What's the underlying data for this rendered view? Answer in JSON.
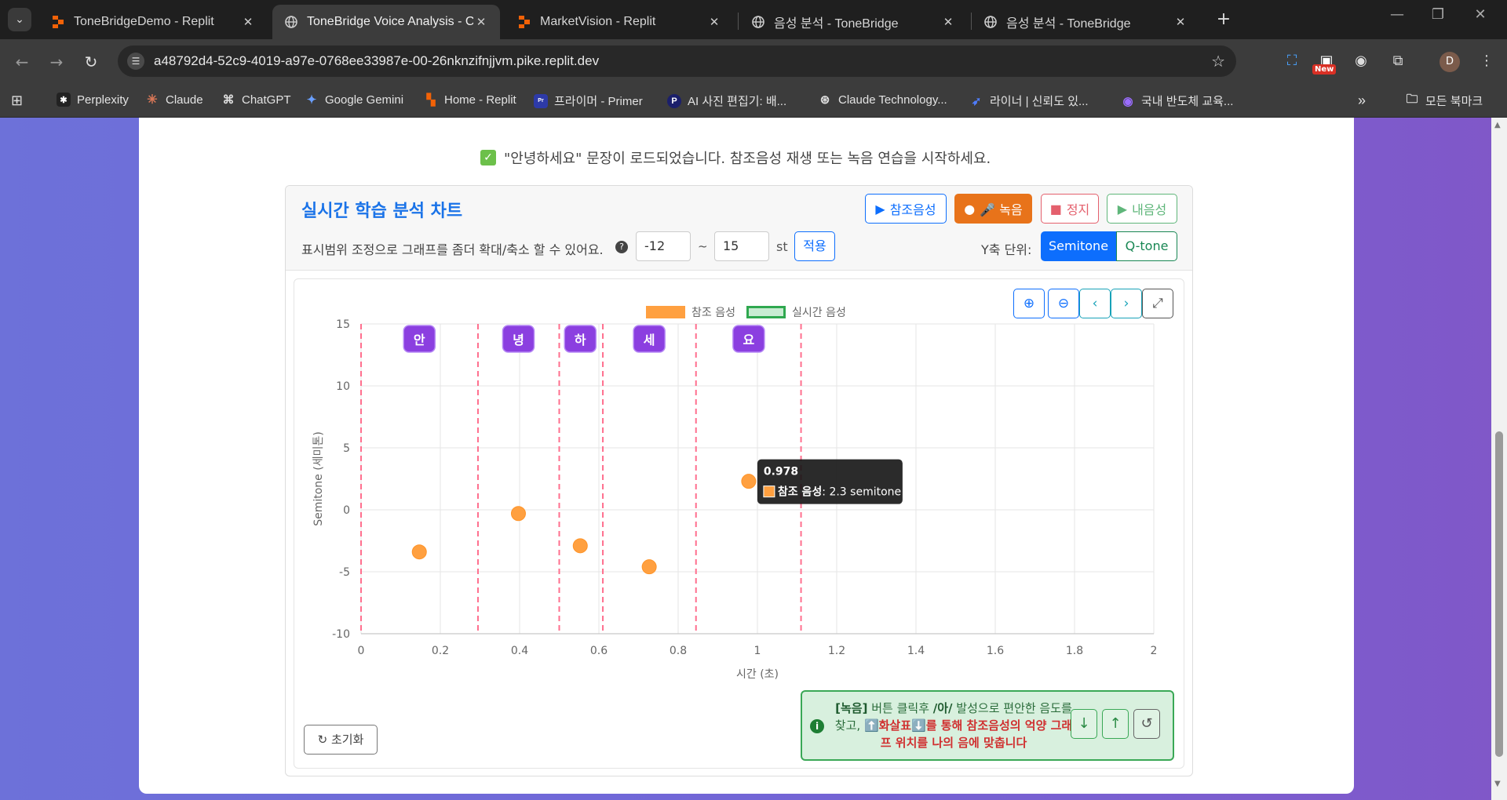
{
  "browser": {
    "tabs": [
      {
        "title": "ToneBridgeDemo - Replit",
        "icon": "replit-icon"
      },
      {
        "title": "ToneBridge Voice Analysis - Cl",
        "icon": "globe-icon"
      },
      {
        "title": "MarketVision - Replit",
        "icon": "replit-icon"
      },
      {
        "title": "음성 분석 - ToneBridge",
        "icon": "globe-icon"
      },
      {
        "title": "음성 분석 - ToneBridge",
        "icon": "globe-icon"
      }
    ],
    "close_glyph": "✕",
    "url": "a48792d4-52c9-4019-a97e-0768ee33987e-00-26nknzifnjjvm.pike.replit.dev",
    "new_badge": "New",
    "profile_initial": "D",
    "bookmarks": [
      {
        "label": "Perplexity",
        "color": "#222222"
      },
      {
        "label": "Claude",
        "color": "#d97757"
      },
      {
        "label": "ChatGPT",
        "color": "#555555"
      },
      {
        "label": "Google Gemini",
        "color": "#4a7de8"
      },
      {
        "label": "Home - Replit",
        "color": "#f26207"
      },
      {
        "label": "프라이머 - Primer",
        "color": "#2d3aa8"
      },
      {
        "label": "AI 사진 편집기: 배...",
        "color": "#1b1f6b"
      },
      {
        "label": "Claude Technology...",
        "color": "#444444"
      },
      {
        "label": "라이너 | 신뢰도 있...",
        "color": "#3b5bdb"
      },
      {
        "label": "국내 반도체 교육...",
        "color": "#7c3aed"
      }
    ],
    "all_bookmarks": "모든 북마크"
  },
  "status_message": "\"안녕하세요\" 문장이 로드되었습니다. 참조음성 재생 또는 녹음 연습을 시작하세요.",
  "panel": {
    "title": "실시간 학습 분석 차트",
    "buttons": {
      "reference": "참조음성",
      "record": "🎤 녹음",
      "stop": "정지",
      "my_voice": "내음성"
    },
    "range_hint": "표시범위 조정으로 그래프를 좀더 확대/축소 할 수 있어요.",
    "range_min": "-12",
    "range_max": "15",
    "range_sep": "~",
    "range_unit": "st",
    "apply": "적용",
    "y_unit_label": "Y축 단위:",
    "y_unit_options": [
      "Semitone",
      "Q-tone"
    ],
    "reset": "초기화",
    "tip": {
      "bold_prefix": "[녹음]",
      "part1": " 버튼 클릭후 ",
      "bold_ah": "/아/",
      "part2": " 발성으로 편안한 음도를 찾고, ",
      "arrows": "⬆️화살표⬇️",
      "part3": "를 통해 참조음성의 억양 그래프 위치를 나의 음에 맞춥니다"
    }
  },
  "chart_data": {
    "type": "scatter",
    "xlabel": "시간 (초)",
    "ylabel": "Semitone (세미톤)",
    "xlim": [
      0,
      2.0
    ],
    "ylim": [
      -10,
      15
    ],
    "x_ticks": [
      0,
      0.2,
      0.4,
      0.6,
      0.8,
      1.0,
      1.2,
      1.4,
      1.6,
      1.8,
      2.0
    ],
    "y_ticks": [
      15,
      10,
      5,
      0,
      -5,
      -10
    ],
    "legend": [
      "참조 음성",
      "실시간 음성"
    ],
    "legend_position": "top-center",
    "series": [
      {
        "name": "참조 음성",
        "color": "#ffa040",
        "points": [
          {
            "x": 0.147,
            "y": -3.4
          },
          {
            "x": 0.397,
            "y": -0.3
          },
          {
            "x": 0.553,
            "y": -2.9
          },
          {
            "x": 0.727,
            "y": -4.6
          },
          {
            "x": 0.978,
            "y": 2.3
          }
        ]
      },
      {
        "name": "실시간 음성",
        "color": "#2fa84f",
        "points": []
      }
    ],
    "syllables": [
      {
        "label": "안",
        "x": 0.147
      },
      {
        "label": "녕",
        "x": 0.397
      },
      {
        "label": "하",
        "x": 0.553
      },
      {
        "label": "세",
        "x": 0.727
      },
      {
        "label": "요",
        "x": 0.978
      }
    ],
    "boundaries": [
      0,
      0.295,
      0.5,
      0.61,
      0.845,
      1.11
    ],
    "tooltip": {
      "title": "0.978",
      "series": "참조 음성",
      "value": "2.3 semitone"
    },
    "grid": true
  }
}
